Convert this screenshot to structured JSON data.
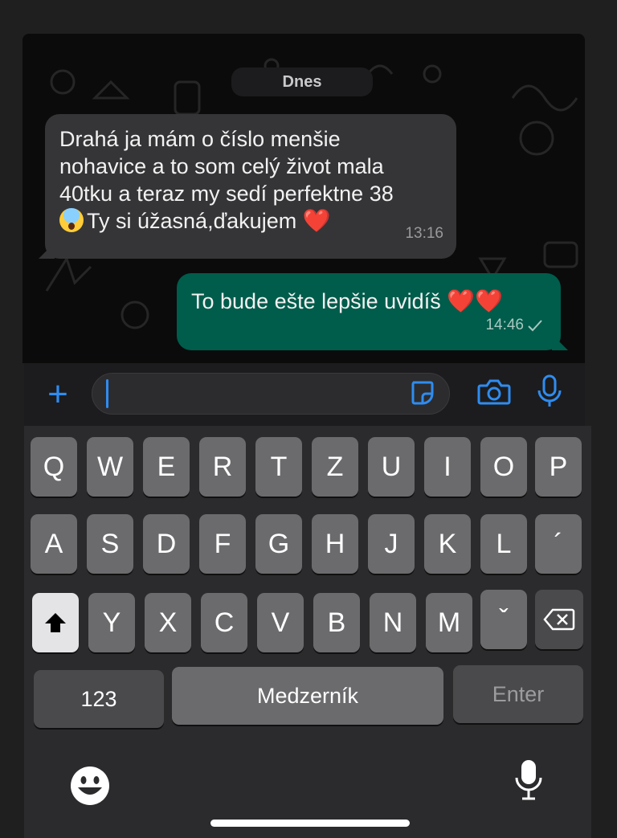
{
  "chat": {
    "date_label": "Dnes",
    "incoming": {
      "lines": [
        "Drahá ja mám o číslo menšie",
        "nohavice a to som celý život mala",
        "40tku a teraz my sedí perfektne 38"
      ],
      "last_line_text": "Ty si úžasná,ďakujem ",
      "emoji_start": "😱",
      "emoji_end": "❤️",
      "time": "13:16"
    },
    "outgoing": {
      "text": "To bude ešte lepšie uvidíš ",
      "emojis": "❤️❤️",
      "time": "14:46",
      "status_icon": "single-check-icon"
    }
  },
  "input_bar": {
    "value": "",
    "accent_color": "#2f8cf0",
    "icons": [
      "plus-icon",
      "sticker-icon",
      "camera-icon",
      "mic-icon"
    ]
  },
  "keyboard": {
    "row1": [
      "Q",
      "W",
      "E",
      "R",
      "T",
      "Z",
      "U",
      "I",
      "O",
      "P"
    ],
    "row2": [
      "A",
      "S",
      "D",
      "F",
      "G",
      "H",
      "J",
      "K",
      "L",
      "´"
    ],
    "row3": [
      "Y",
      "X",
      "C",
      "V",
      "B",
      "N",
      "M",
      "ˇ"
    ],
    "numbers_label": "123",
    "space_label": "Medzerník",
    "enter_label": "Enter",
    "icons": [
      "shift-icon",
      "backspace-icon",
      "emoji-icon",
      "dictation-mic-icon"
    ]
  },
  "colors": {
    "incoming_bubble": "#353537",
    "outgoing_bubble": "#005c4b",
    "key": "#6b6b6e",
    "keyboard_bg": "#2b2b2d"
  }
}
